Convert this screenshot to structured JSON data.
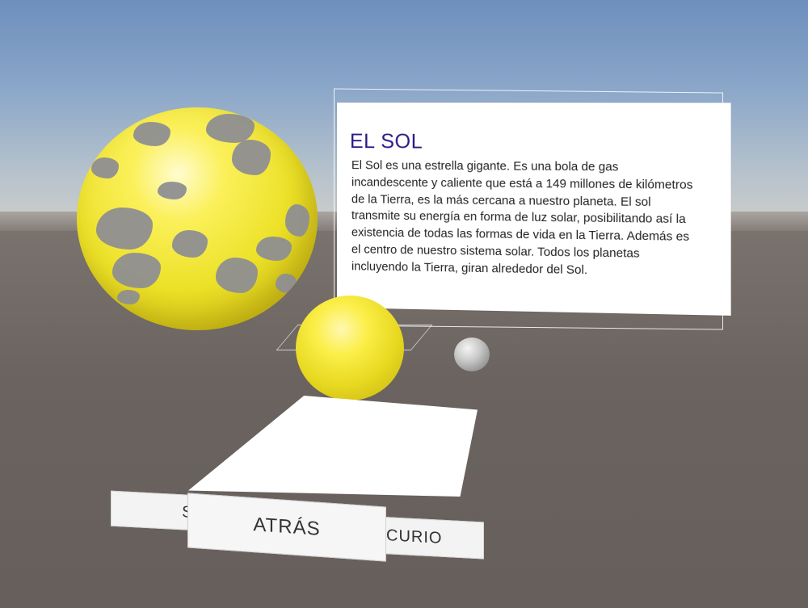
{
  "scene": {
    "sky_color": "#8aa6c9",
    "ground_color": "#6b6460",
    "sun_color": "#f2e52c",
    "spot_color": "#8e8e91",
    "mercury_color": "#b5b5b5"
  },
  "info_panel": {
    "title": "EL SOL",
    "title_color": "#2c1a86",
    "body": "El Sol es una estrella gigante. Es una bola de gas incandescente y caliente que está a 149 millones de kilómetros de la Tierra, es la más cercana a nuestro planeta. El sol transmite su energía en forma de luz solar, posibilitando así la existencia de todas las formas de vida en la Tierra. Además es el centro de nuestro sistema solar. Todos los planetas incluyendo la Tierra, giran alrededor del Sol."
  },
  "buttons": {
    "sol_label": "SO",
    "atras_label": "ATRÁS",
    "mercurio_label": "CURIO"
  }
}
